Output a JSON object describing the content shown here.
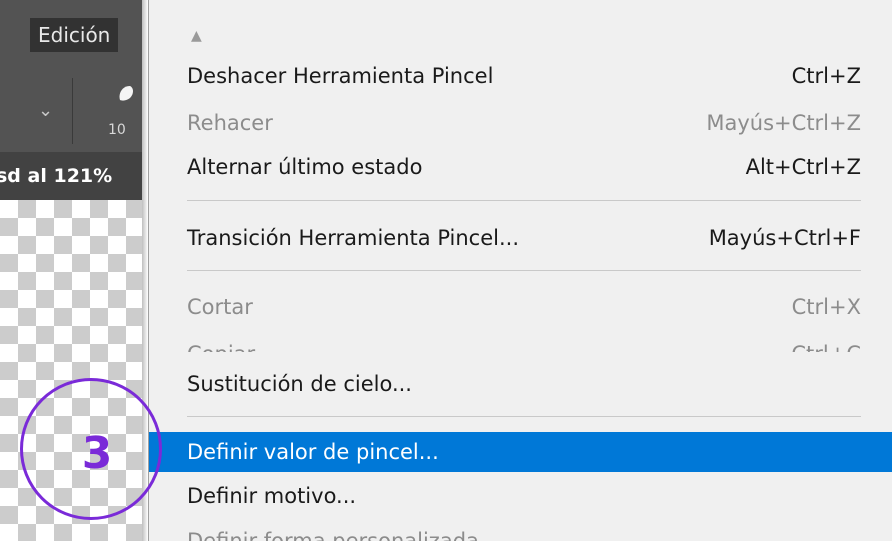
{
  "menubar": {
    "edit_menu_label": "Edición"
  },
  "options_bar": {
    "brush_size": "10"
  },
  "document_tab": {
    "title": "sd al 121%"
  },
  "dropdown": {
    "scroll_indicator": "▲",
    "items": [
      {
        "label": "Deshacer Herramienta Pincel",
        "shortcut": "Ctrl+Z",
        "enabled": true
      },
      {
        "label": "Rehacer",
        "shortcut": "Mayús+Ctrl+Z",
        "enabled": false
      },
      {
        "label": "Alternar último estado",
        "shortcut": "Alt+Ctrl+Z",
        "enabled": true
      },
      {
        "label": "Transición Herramienta Pincel...",
        "shortcut": "Mayús+Ctrl+F",
        "enabled": true
      },
      {
        "label": "Cortar",
        "shortcut": "Ctrl+X",
        "enabled": false
      },
      {
        "label": "Copiar",
        "shortcut": "Ctrl+C",
        "enabled": false
      },
      {
        "label": "Sustitución de cielo...",
        "shortcut": "",
        "enabled": true
      },
      {
        "label": "Definir valor de pincel...",
        "shortcut": "",
        "enabled": true,
        "highlighted": true
      },
      {
        "label": "Definir motivo...",
        "shortcut": "",
        "enabled": true
      },
      {
        "label": "Definir forma personalizada...",
        "shortcut": "",
        "enabled": false
      }
    ]
  },
  "annotation": {
    "step_number": "3",
    "color": "#7a2ad8"
  },
  "colors": {
    "highlight": "#0078d7",
    "menu_bg": "#f0f0f0",
    "ps_panel": "#535353"
  }
}
